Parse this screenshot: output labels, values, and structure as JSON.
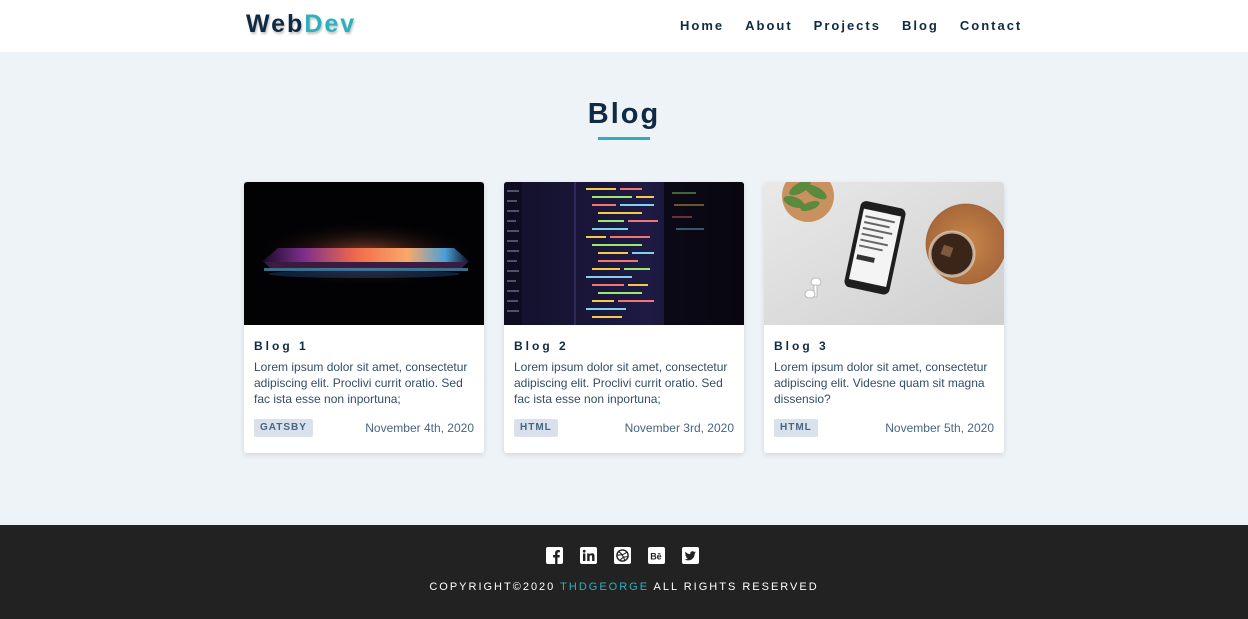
{
  "header": {
    "logo_part1": "Web",
    "logo_part2": "Dev",
    "nav": [
      "Home",
      "About",
      "Projects",
      "Blog",
      "Contact"
    ]
  },
  "section": {
    "title": "Blog"
  },
  "blogs": [
    {
      "title": "Blog 1",
      "desc": "Lorem ipsum dolor sit amet, consectetur adipiscing elit. Proclivi currit oratio. Sed fac ista esse non inportuna;",
      "tag": "GATSBY",
      "date": "November 4th, 2020",
      "image": "laptop-glow-image"
    },
    {
      "title": "Blog 2",
      "desc": "Lorem ipsum dolor sit amet, consectetur adipiscing elit. Proclivi currit oratio. Sed fac ista esse non inportuna;",
      "tag": "HTML",
      "date": "November 3rd, 2020",
      "image": "code-screen-image"
    },
    {
      "title": "Blog 3",
      "desc": "Lorem ipsum dolor sit amet, consectetur adipiscing elit. Videsne quam sit magna dissensio?",
      "tag": "HTML",
      "date": "November 5th, 2020",
      "image": "phone-desk-image"
    }
  ],
  "footer": {
    "socials": [
      "facebook-icon",
      "linkedin-icon",
      "dribbble-icon",
      "behance-icon",
      "twitter-icon"
    ],
    "copyright_prefix": "COPYRIGHT©2020",
    "copyright_name": "THDGEORGE",
    "copyright_suffix": "ALL RIGHTS RESERVED"
  },
  "colors": {
    "primary_dark": "#102a43",
    "accent": "#2cb1bc",
    "page_bg": "#eef3f7",
    "footer_bg": "#222222"
  }
}
